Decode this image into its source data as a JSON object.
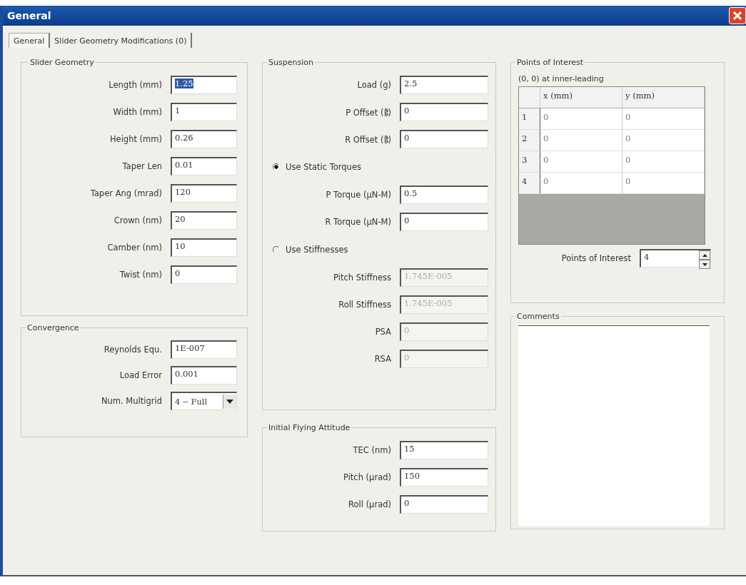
{
  "window": {
    "title": "General"
  },
  "tabs": [
    {
      "label": "General",
      "selected": true
    },
    {
      "label": "Slider Geometry Modifications (0)",
      "selected": false
    }
  ],
  "slider_geometry": {
    "title": "Slider Geometry",
    "fields": [
      {
        "label": "Length (mm)",
        "value": "1.25",
        "text_selected": true
      },
      {
        "label": "Width (mm)",
        "value": "1",
        "text_selected": false
      },
      {
        "label": "Height (mm)",
        "value": "0.26",
        "text_selected": false
      },
      {
        "label": "Taper Len",
        "value": "0.01",
        "text_selected": false
      },
      {
        "label": "Taper Ang (mrad)",
        "value": "120",
        "text_selected": false
      },
      {
        "label": "Crown (nm)",
        "value": "20",
        "text_selected": false
      },
      {
        "label": "Camber (nm)",
        "value": "10",
        "text_selected": false
      },
      {
        "label": "Twist (nm)",
        "value": "0",
        "text_selected": false
      }
    ]
  },
  "convergence": {
    "title": "Convergence",
    "fields": [
      {
        "kind": "text",
        "label": "Reynolds Equ.",
        "value": "1E-007"
      },
      {
        "kind": "text",
        "label": "Load Error",
        "value": "0.001"
      },
      {
        "kind": "dropdown",
        "label": "Num. Multigrid",
        "value": "4 -- Full"
      }
    ]
  },
  "suspension": {
    "title": "Suspension",
    "items": [
      {
        "kind": "field",
        "label": "Load (g)",
        "value": "2.5",
        "disabled": false
      },
      {
        "kind": "field",
        "label": "P Offset (ह्रै)",
        "value": "0",
        "disabled": false
      },
      {
        "kind": "field",
        "label": "R Offset (ह्रै)",
        "value": "0",
        "disabled": false
      },
      {
        "kind": "radio",
        "label": "Use Static Torques",
        "selected": true
      },
      {
        "kind": "field",
        "label": "P Torque (µN-M)",
        "value": "0.5",
        "disabled": false
      },
      {
        "kind": "field",
        "label": "R Torque (µN-M)",
        "value": "0",
        "disabled": false
      },
      {
        "kind": "radio",
        "label": "Use Stiffnesses",
        "selected": false
      },
      {
        "kind": "field",
        "label": "Pitch Stiffness",
        "value": "1.745E-005",
        "disabled": true
      },
      {
        "kind": "field",
        "label": "Roll Stiffness",
        "value": "1.745E-005",
        "disabled": true
      },
      {
        "kind": "field",
        "label": "PSA",
        "value": "0",
        "disabled": true
      },
      {
        "kind": "field",
        "label": "RSA",
        "value": "0",
        "disabled": true
      }
    ]
  },
  "initial_flying_attitude": {
    "title": "Initial Flying Attitude",
    "fields": [
      {
        "label": "TEC (nm)",
        "value": "15"
      },
      {
        "label": "Pitch (µrad)",
        "value": "150"
      },
      {
        "label": "Roll (µrad)",
        "value": "0"
      }
    ]
  },
  "points_of_interest": {
    "title": "Points of Interest",
    "note": "(0, 0) at inner-leading",
    "table": {
      "columns": [
        "x (mm)",
        "y (mm)"
      ],
      "rows": [
        {
          "index": "1",
          "cells": [
            "0",
            "0"
          ]
        },
        {
          "index": "2",
          "cells": [
            "0",
            "0"
          ]
        },
        {
          "index": "3",
          "cells": [
            "0",
            "0"
          ]
        },
        {
          "index": "4",
          "cells": [
            "0",
            "0"
          ]
        }
      ]
    },
    "count": {
      "label": "Points of Interest",
      "value": "4"
    }
  },
  "comments": {
    "title": "Comments"
  }
}
